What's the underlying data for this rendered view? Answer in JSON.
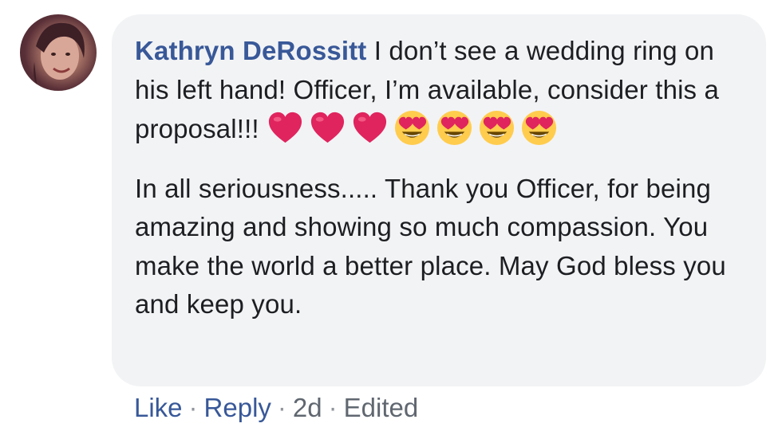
{
  "comment": {
    "author": "Kathryn DeRossitt",
    "line1_text": " I don’t see a wedding ring on his left hand! Officer, I’m available, consider this a proposal!!! ",
    "emojis": [
      "heart-icon",
      "heart-icon",
      "heart-icon",
      "heart-eyes-icon",
      "heart-eyes-icon",
      "heart-eyes-icon",
      "heart-eyes-icon"
    ],
    "para2": "In all seriousness..... Thank you Officer, for being amazing and showing so much compassion. You make the world a better place. May God bless you and keep you."
  },
  "actions": {
    "like": "Like",
    "reply": "Reply",
    "time": "2d",
    "edited": "Edited",
    "separator": "·"
  },
  "colors": {
    "bubble_bg": "#f2f3f5",
    "link": "#385898",
    "text": "#1c1e21",
    "meta": "#606770",
    "heart": "#e0245e",
    "emoji_face": "#ffcc4d"
  }
}
